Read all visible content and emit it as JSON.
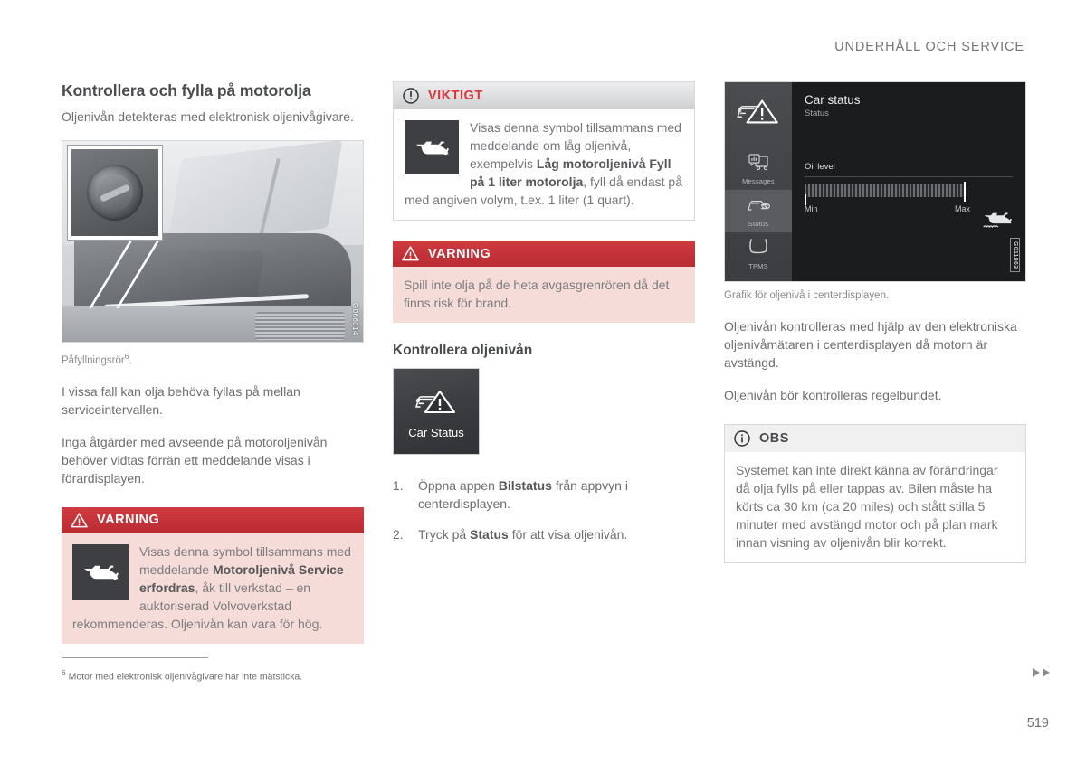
{
  "header": {
    "title": "UNDERHÅLL OCH SERVICE"
  },
  "left_column": {
    "section_title": "Kontrollera och fylla på motorolja",
    "intro": "Oljenivån detekteras med elektronisk oljenivågivare.",
    "figure": {
      "name": "engine-bay-photo",
      "image_id": "G066014",
      "caption_text": "Påfyllningsrör",
      "caption_footnote_marker": "6",
      "caption_suffix": "."
    },
    "paragraph_1": "I vissa fall kan olja behöva fyllas på mellan serviceintervallen.",
    "paragraph_2": "Inga åtgärder med avseende på motoroljenivån behöver vidtas förrän ett meddelande visas i förardisplayen.",
    "warning_box": {
      "label": "VARNING",
      "icon": "warning-triangle-icon",
      "symbol_icon": "oil-can-icon",
      "text_part_1": "Visas denna symbol tillsammans med meddelande ",
      "text_bold_1": "Motoroljenivå Service erfordras",
      "text_part_2": ", åk till verkstad – en auktoriserad Volvoverkstad rekommenderas. Oljenivån kan vara för hög."
    }
  },
  "mid_column": {
    "important_box": {
      "label": "VIKTIGT",
      "icon": "exclamation-circle-icon",
      "symbol_icon": "oil-can-icon",
      "text_part_1": "Visas denna symbol tillsammans med meddelande om låg oljenivå, exempelvis ",
      "text_bold_1": "Låg motoroljenivå Fyll på 1 liter motorolja",
      "text_part_2": ", fyll då endast på med angiven volym, t.ex. 1 liter (1 quart)."
    },
    "warning_box": {
      "label": "VARNING",
      "icon": "warning-triangle-icon",
      "text": "Spill inte olja på de heta avgasgrenrören då det finns risk för brand."
    },
    "sub_title": "Kontrollera oljenivån",
    "app_tile": {
      "label": "Car Status",
      "icon": "car-status-icon"
    },
    "steps": [
      {
        "num": "1.",
        "text_part_1": "Öppna appen ",
        "text_bold": "Bilstatus",
        "text_part_2": " från appvyn i centerdisplayen."
      },
      {
        "num": "2.",
        "text_part_1": "Tryck på ",
        "text_bold": "Status",
        "text_part_2": " för att visa oljenivån."
      }
    ]
  },
  "right_column": {
    "center_display": {
      "image_id": "G011863",
      "title": "Car status",
      "subtitle": "Status",
      "gauge_label": "Oil level",
      "gauge_min_label": "Min",
      "gauge_max_label": "Max",
      "gauge_fill_percent": 98,
      "oil_symbol_icon": "oil-level-icon",
      "sidebar": {
        "top_icon": "car-status-icon",
        "items": [
          {
            "label": "Messages",
            "icon": "messages-icon",
            "active": false
          },
          {
            "label": "Status",
            "icon": "status-icon",
            "active": true
          },
          {
            "label": "TPMS",
            "icon": "tpms-icon",
            "active": false
          },
          {
            "label": "",
            "icon": "diagnostics-icon",
            "active": false
          }
        ]
      }
    },
    "caption": "Grafik för oljenivå i centerdisplayen.",
    "paragraph_1": "Oljenivån kontrolleras med hjälp av den elektroniska oljenivåmätaren i centerdisplayen då motorn är avstängd.",
    "paragraph_2": "Oljenivån bör kontrolleras regelbundet.",
    "note_box": {
      "label": "OBS",
      "icon": "info-circle-icon",
      "text": "Systemet kan inte direkt känna av förändringar då olja fylls på eller tappas av. Bilen måste ha körts ca 30 km (ca 20 miles) och stått stilla 5 minuter med avstängd motor och på plan mark innan visning av oljenivån blir korrekt."
    }
  },
  "footer": {
    "footnote_marker": "6",
    "footnote_text": "Motor med elektronisk oljenivågivare har inte mätsticka.",
    "page_number": "519",
    "next_arrows_icon": "double-right-arrow-icon"
  },
  "colors": {
    "warning_red": "#c22f36",
    "warning_bg": "#f6dcd8",
    "important_red": "#d8383d",
    "body_text": "#6d6e70",
    "heading_text": "#4a4b4d"
  }
}
